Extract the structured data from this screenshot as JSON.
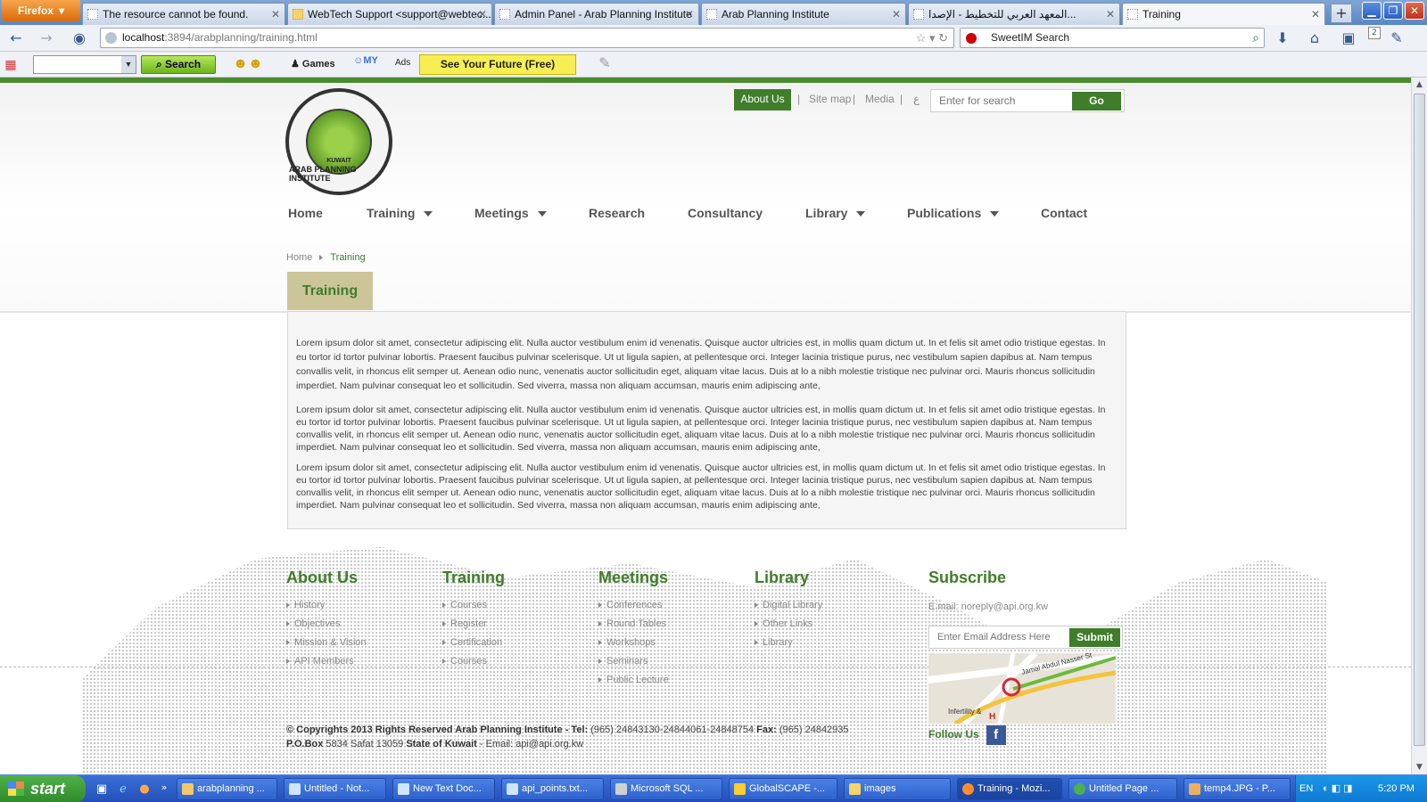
{
  "browser": {
    "menu_button": "Firefox",
    "tabs": [
      {
        "title": "The resource cannot be found."
      },
      {
        "title": "WebTech Support <support@webtec..."
      },
      {
        "title": "Admin Panel - Arab Planning Institute"
      },
      {
        "title": "Arab Planning Institute"
      },
      {
        "title": "المعهد العربي للتخطيط - الإصدا..."
      },
      {
        "title": "Training"
      }
    ],
    "url_host": "localhost",
    "url_path": ":3894/arabplanning/training.html",
    "search_placeholder": "SweetIM Search",
    "notif_count": "2"
  },
  "addon_toolbar": {
    "search_label": "Search",
    "games_label": "Games",
    "ads_label": "Ads",
    "future_label": "See Your Future (Free)"
  },
  "site": {
    "logo_text": "ARAB PLANNING INSTITUTE",
    "logo_country": "KUWAIT",
    "top_links": [
      "About Us",
      "Site map",
      "Media",
      "ع"
    ],
    "search_placeholder": "Enter for search",
    "search_button": "Go",
    "nav": [
      {
        "label": "Home"
      },
      {
        "label": "Training"
      },
      {
        "label": "Meetings"
      },
      {
        "label": "Research"
      },
      {
        "label": "Consultancy"
      },
      {
        "label": "Library"
      },
      {
        "label": "Publications"
      },
      {
        "label": "Contact"
      }
    ],
    "breadcrumb": [
      "Home",
      "Training"
    ],
    "page_title": "Training",
    "paragraphs": [
      "Lorem ipsum dolor sit amet, consectetur adipiscing elit. Nulla auctor vestibulum enim id venenatis. Quisque auctor ultricies est, in mollis quam dictum ut. In et felis sit amet odio tristique egestas. In eu tortor id tortor pulvinar lobortis. Praesent faucibus pulvinar scelerisque. Ut ut ligula sapien, at pellentesque orci. Integer lacinia tristique purus, nec vestibulum sapien dapibus at. Nam tempus convallis velit, in rhoncus elit semper ut. Aenean odio nunc, venenatis auctor sollicitudin eget, aliquam vitae lacus. Duis at lo a nibh molestie tristique nec pulvinar orci. Mauris rhoncus sollicitudin imperdiet. Nam pulvinar consequat leo et sollicitudin. Sed viverra, massa non aliquam accumsan, mauris enim adipiscing ante,",
      "Lorem ipsum dolor sit amet, consectetur adipiscing elit. Nulla auctor vestibulum enim id venenatis. Quisque auctor ultricies est, in mollis quam dictum ut. In et felis sit amet odio tristique egestas. In eu tortor id tortor pulvinar lobortis. Praesent faucibus pulvinar scelerisque. Ut ut ligula sapien, at pellentesque orci. Integer lacinia tristique purus, nec vestibulum sapien dapibus at. Nam tempus convallis velit, in rhoncus elit semper ut. Aenean odio nunc, venenatis auctor sollicitudin eget, aliquam vitae lacus. Duis at lo a nibh molestie tristique nec pulvinar orci. Mauris rhoncus sollicitudin imperdiet. Nam pulvinar consequat leo et sollicitudin. Sed viverra, massa non aliquam accumsan, mauris enim adipiscing ante,",
      "Lorem ipsum dolor sit amet, consectetur adipiscing elit. Nulla auctor vestibulum enim id venenatis. Quisque auctor ultricies est, in mollis quam dictum ut. In et felis sit amet odio tristique egestas. In eu tortor id tortor pulvinar lobortis. Praesent faucibus pulvinar scelerisque. Ut ut ligula sapien, at pellentesque orci. Integer lacinia tristique purus, nec vestibulum sapien dapibus at. Nam tempus convallis velit, in rhoncus elit semper ut. Aenean odio nunc, venenatis auctor sollicitudin eget, aliquam vitae lacus. Duis at lo a nibh molestie tristique nec pulvinar orci. Mauris rhoncus sollicitudin imperdiet. Nam pulvinar consequat leo et sollicitudin. Sed viverra, massa non aliquam accumsan, mauris enim adipiscing ante,"
    ],
    "footer": {
      "columns": [
        {
          "title": "About Us",
          "items": [
            "History",
            "Objectives",
            "Mission & Vision",
            "API Members"
          ]
        },
        {
          "title": "Training",
          "items": [
            "Courses",
            "Register",
            "Certification",
            "Courses"
          ]
        },
        {
          "title": "Meetings",
          "items": [
            "Conferences",
            "Round Tables",
            "Workshops",
            "Seminars",
            "Public Lecture"
          ]
        },
        {
          "title": "Library",
          "items": [
            "Digital Library",
            "Other Links",
            "Library"
          ]
        }
      ],
      "subscribe_title": "Subscribe",
      "subscribe_email": "E.mail: noreply@api.org.kw",
      "subscribe_placeholder": "Enter Email Address Here",
      "subscribe_button": "Submit",
      "map_label_street": "Jamal Abdul Nasser St",
      "map_label_place": "Infertility &",
      "follow_label": "Follow Us",
      "copyright_line1_bold": "© Copyrights 2013 Rights Reserved Arab Planning Institute - Tel:",
      "copyright_tel": " (965) 24843130-24844061-24848754 ",
      "copyright_fax_label": "Fax:",
      "copyright_fax": " (965) 24842935",
      "copyright_pobox_label": "P.O.Box",
      "copyright_pobox": " 5834 Safat 13059 ",
      "copyright_state": "State of Kuwait",
      "copyright_email": " - Email: api@api.org.kw"
    }
  },
  "taskbar": {
    "start_label": "start",
    "items": [
      {
        "label": "arabplanning ..."
      },
      {
        "label": "Untitled - Not..."
      },
      {
        "label": "New Text Doc..."
      },
      {
        "label": "api_points.txt..."
      },
      {
        "label": "Microsoft SQL ..."
      },
      {
        "label": "GlobalSCAPE -..."
      },
      {
        "label": "images"
      },
      {
        "label": "Training - Mozi..."
      },
      {
        "label": "Untitled Page ..."
      },
      {
        "label": "temp4.JPG - P..."
      }
    ],
    "language": "EN",
    "clock": "5:20 PM"
  },
  "colors": {
    "brand_green": "#3f7d2a",
    "title_tab_bg": "#ccc59a",
    "taskbar_blue": "#2451b8"
  }
}
